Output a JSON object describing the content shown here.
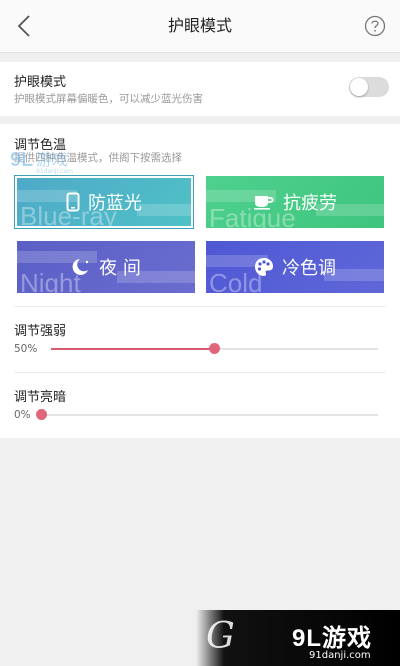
{
  "header": {
    "title": "护眼模式",
    "back_icon": "chevron-left-icon",
    "help_icon": "question-circle-icon"
  },
  "eye_mode": {
    "title": "护眼模式",
    "description": "护眼模式屏幕偏暖色，可以减少蓝光伤害",
    "enabled": false
  },
  "color_temp": {
    "title": "调节色温",
    "description": "提供四种色温模式，供阁下按需选择",
    "modes": [
      {
        "label": "防蓝光",
        "bg_word": "Blue-ray",
        "icon": "phone-icon",
        "selected": true
      },
      {
        "label": "抗疲劳",
        "bg_word": "Fatigue",
        "icon": "coffee-cup-icon",
        "selected": false
      },
      {
        "label": "夜 间",
        "bg_word": "Night",
        "icon": "moon-icon",
        "selected": false
      },
      {
        "label": "冷色调",
        "bg_word": "Cold",
        "icon": "palette-icon",
        "selected": false
      }
    ]
  },
  "intensity": {
    "label": "调节强弱",
    "value_text": "50%",
    "value": 0.5
  },
  "brightness": {
    "label": "调节亮暗",
    "value_text": "0%",
    "value": 0.0
  },
  "watermark": {
    "brand": "9L游戏",
    "domain": "91danji.com",
    "top_text": "91游戏",
    "top_sub": "91danji.com"
  },
  "colors": {
    "accent": "#e0677a",
    "blue_ray": "#4fb5c8",
    "fatigue": "#4fd08e",
    "night": "#5a5fc6",
    "cold": "#4f58d4"
  }
}
